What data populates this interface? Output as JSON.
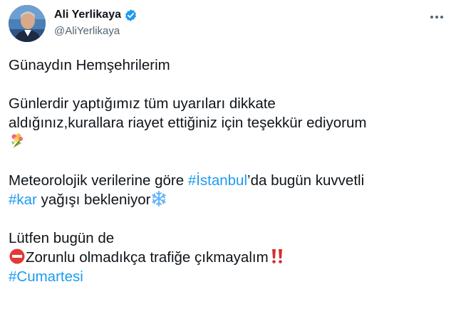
{
  "author": {
    "display_name": "Ali Yerlikaya",
    "handle": "@AliYerlikaya",
    "verified": true,
    "accent_color": "#1d9bf0"
  },
  "menu": {
    "icon": "more-horizontal-icon"
  },
  "tweet": {
    "line1": "Günaydın Hemşehrilerim",
    "line2": "Günlerdir yaptığımız tüm uyarıları dikkate",
    "line3": "aldığınız,kurallara riayet ettiğiniz için teşekkür ediyorum",
    "line4_emoji": "bouquet-icon",
    "line5_before": "Meteorolojik verilerine göre ",
    "hashtag_istanbul": "#İstanbul",
    "line5_after": "’da bugün kuvvetli",
    "hashtag_kar": "#kar",
    "line6_after": " yağışı bekleniyor",
    "line6_emoji": "snowflake-icon",
    "line7": "Lütfen bugün de",
    "line8_emoji_before": "no-entry-icon",
    "line8_text": "Zorunlu olmadıkça trafiğe çıkmayalım",
    "line8_emoji_after": "double-exclamation-icon",
    "hashtag_cumartesi": "#Cumartesi"
  }
}
